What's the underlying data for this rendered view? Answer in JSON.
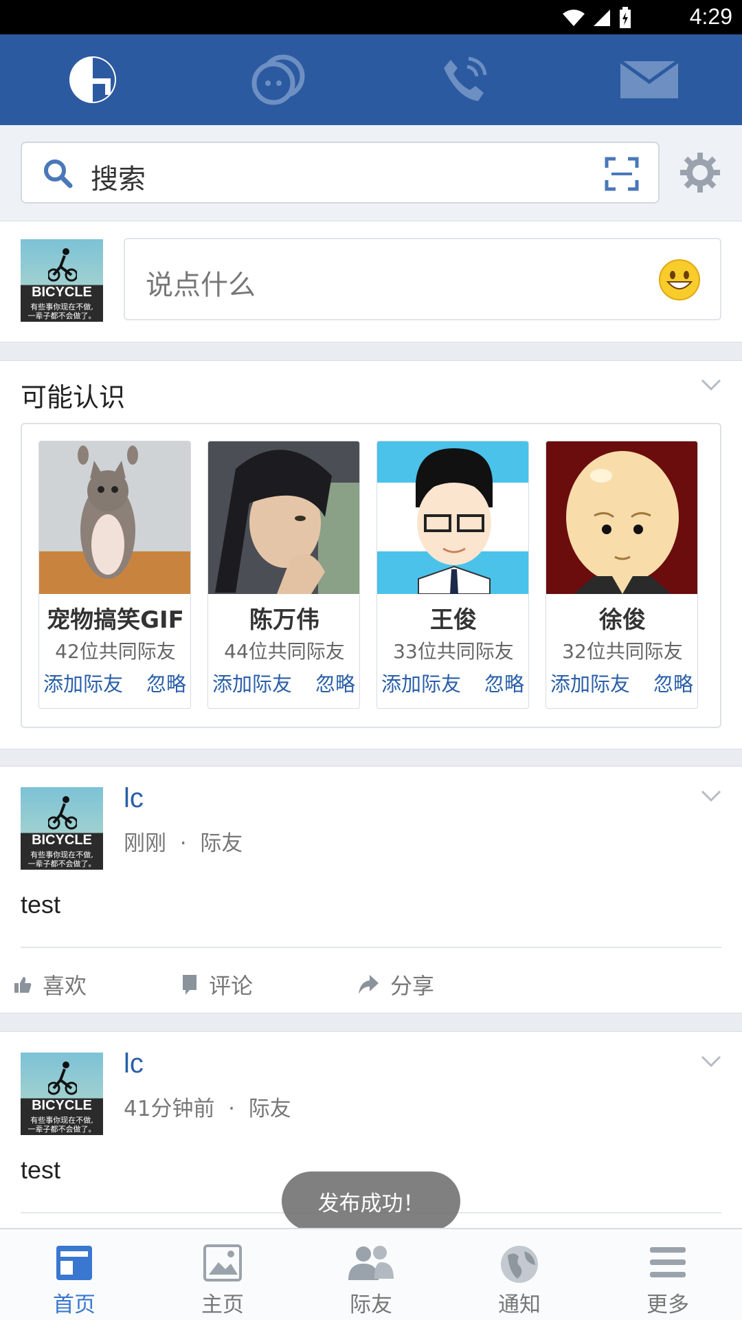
{
  "status_bar": {
    "time": "4:29"
  },
  "top_nav": {
    "tabs": [
      {
        "icon": "app-logo-icon"
      },
      {
        "icon": "chat-bubbles-icon"
      },
      {
        "icon": "phone-call-icon"
      },
      {
        "icon": "mail-icon"
      }
    ]
  },
  "search": {
    "placeholder": "搜索"
  },
  "composer": {
    "placeholder": "说点什么"
  },
  "pymk": {
    "title": "可能认识",
    "people": [
      {
        "name": "宠物搞笑GIF",
        "mutual": "42位共同际友",
        "add": "添加际友",
        "ignore": "忽略"
      },
      {
        "name": "陈万伟",
        "mutual": "44位共同际友",
        "add": "添加际友",
        "ignore": "忽略"
      },
      {
        "name": "王俊",
        "mutual": "33位共同际友",
        "add": "添加际友",
        "ignore": "忽略"
      },
      {
        "name": "徐俊",
        "mutual": "32位共同际友",
        "add": "添加际友",
        "ignore": "忽略"
      }
    ]
  },
  "avatar_text": {
    "word": "BICYCLE",
    "line1": "有些事你现在不做,",
    "line2": "一辈子都不会做了。"
  },
  "posts": [
    {
      "author": "lc",
      "time": "刚刚",
      "audience": "际友",
      "content": "test",
      "actions": {
        "like": "喜欢",
        "comment": "评论",
        "share": "分享"
      }
    },
    {
      "author": "lc",
      "time": "41分钟前",
      "audience": "际友",
      "content": "test"
    }
  ],
  "toast": "发布成功！",
  "bottom_nav": {
    "items": [
      {
        "label": "首页"
      },
      {
        "label": "主页"
      },
      {
        "label": "际友"
      },
      {
        "label": "通知"
      },
      {
        "label": "更多"
      }
    ]
  },
  "colors": {
    "brand": "#2c5aa0",
    "link": "#2a5fa9",
    "active": "#3a77d0"
  }
}
